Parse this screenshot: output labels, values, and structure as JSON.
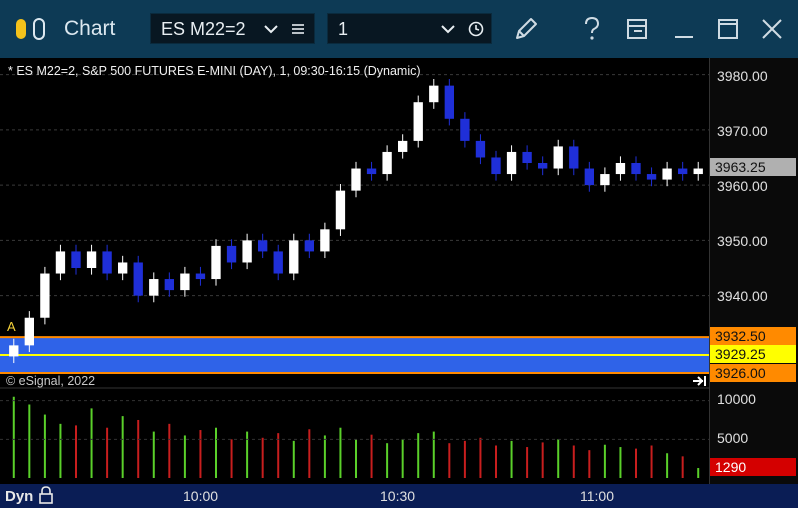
{
  "titlebar": {
    "app_title": "Chart",
    "symbol": "ES M22=2",
    "interval": "1",
    "icons": [
      "app-toggle-icon",
      "chevron-down-icon",
      "menu-icon",
      "chevron-down-icon",
      "clock-icon",
      "pencil-icon",
      "help-icon",
      "panel-icon",
      "minimize-icon",
      "maximize-icon",
      "close-icon"
    ],
    "colors": {
      "bg": "#0d3a55",
      "combo_bg": "#081722"
    }
  },
  "chart": {
    "info": "* ES M22=2, S&P 500 FUTURES E-MINI (DAY), 1, 09:30-16:15 (Dynamic)",
    "copyright": "© eSignal, 2022",
    "marker": "A",
    "price_labels": [
      "3980.00",
      "3970.00",
      "3960.00",
      "3950.00",
      "3940.00"
    ],
    "last_price": "3963.25",
    "zone_top": "3932.50",
    "zone_mid": "3929.25",
    "zone_bottom": "3926.00",
    "volume_labels": [
      "10000",
      "5000"
    ],
    "last_volume": "1290",
    "time_labels": [
      "10:00",
      "10:30",
      "11:00"
    ],
    "footer_label": "Dyn",
    "colors": {
      "up": "#ffffff",
      "down": "#1f2fd8",
      "zone": "#2f63e8",
      "zone_border": "#ff8a00",
      "mid": "#ffff00",
      "vol_up": "#5ad02a",
      "vol_down": "#c81e1e",
      "last_price_bg": "#b0b0b0",
      "axis_bg": "#0a1d55"
    }
  },
  "chart_data": {
    "type": "candlestick",
    "ylim": [
      3926,
      3983
    ],
    "x_ticks": [
      "10:00",
      "10:30",
      "11:00"
    ],
    "series": [
      {
        "values": [
          3931,
          3936,
          3944,
          3948,
          3945,
          3948,
          3944,
          3946,
          3940,
          3943,
          3941,
          3944,
          3943,
          3949,
          3946,
          3950,
          3948,
          3944,
          3950,
          3948,
          3952,
          3959,
          3963,
          3962,
          3966,
          3968,
          3975,
          3978,
          3972,
          3968,
          3965,
          3962,
          3966,
          3964,
          3963,
          3967,
          3963,
          3960,
          3962,
          3964,
          3962,
          3961,
          3963,
          3962,
          3963
        ]
      }
    ],
    "volume_ylim": [
      0,
      10000
    ],
    "volume": [
      10500,
      9500,
      8200,
      7000,
      6800,
      9000,
      6500,
      8000,
      7500,
      6000,
      7000,
      5500,
      6200,
      6500,
      5000,
      6000,
      5200,
      5800,
      4800,
      6300,
      5500,
      6500,
      5000,
      5600,
      4500,
      5000,
      5800,
      6000,
      4500,
      4800,
      5200,
      4200,
      4800,
      4000,
      4600,
      5000,
      4200,
      3600,
      4300,
      4000,
      3800,
      4200,
      3200,
      2800,
      1290
    ]
  }
}
